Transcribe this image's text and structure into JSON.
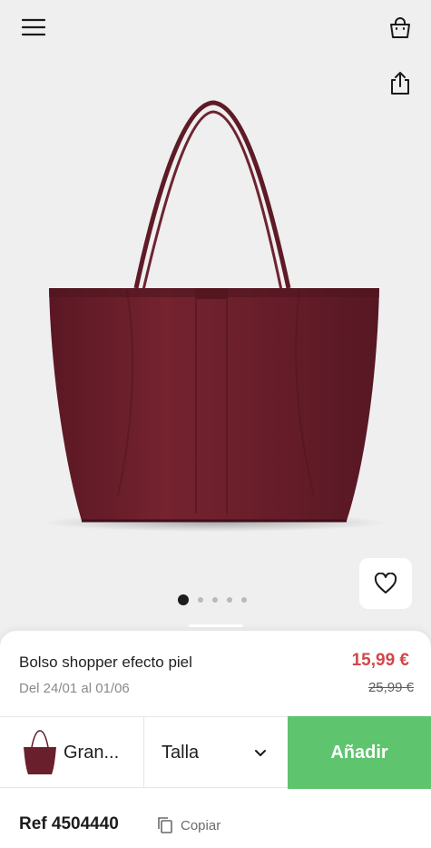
{
  "header": {
    "menu_icon": "hamburger-menu-icon",
    "bag_icon": "shopping-bag-icon",
    "share_icon": "share-icon"
  },
  "gallery": {
    "image": "burgundy-tote-bag",
    "favorite_icon": "heart-outline-icon",
    "pages": 5,
    "current_page": 1
  },
  "product": {
    "title": "Bolso shopper efecto piel",
    "dates": "Del 24/01 al 01/06",
    "price": "15,99 €",
    "old_price": "25,99 €",
    "reference": "Ref 4504440",
    "copy_label": "Copiar"
  },
  "actions": {
    "color_label": "Gran...",
    "size_label": "Talla",
    "add_label": "Añadir"
  },
  "colors": {
    "background": "#efefef",
    "price": "#d0484b",
    "add_button": "#5ec46e",
    "bag": "#6a1f2c"
  }
}
